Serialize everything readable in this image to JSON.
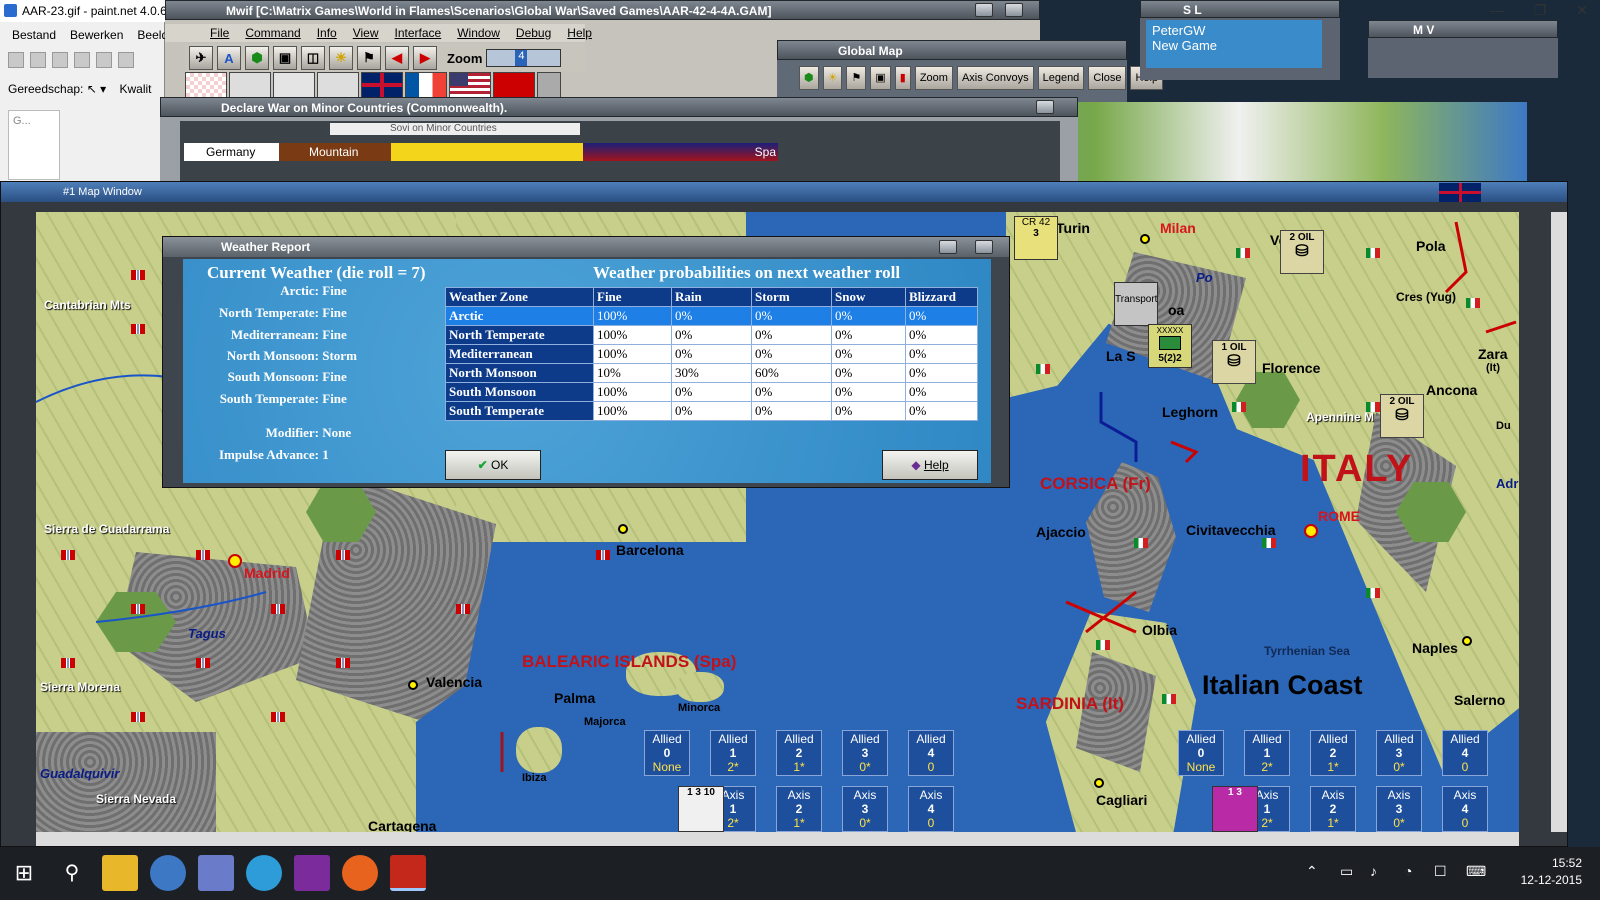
{
  "paint": {
    "title": "AAR-23.gif - paint.net 4.0.6",
    "menu": [
      "Bestand",
      "Bewerken",
      "Beeld"
    ],
    "tool_label": "Gereedschap:",
    "quality_label": "Kwalit",
    "panel_label": "G..."
  },
  "mwif": {
    "title": "Mwif [C:\\Matrix Games\\World in Flames\\Scenarios\\Global War\\Saved Games\\AAR-42-4-4A.GAM]",
    "menu": [
      "File",
      "Command",
      "Info",
      "View",
      "Interface",
      "Window",
      "Debug",
      "Help"
    ],
    "zoom_label": "Zoom",
    "zoom_value": "4"
  },
  "declare_war": {
    "title": "Declare War on Minor Countries (Commonwealth).",
    "header_hint": "Sovi on Minor Countries",
    "row": {
      "country": "Germany",
      "terrain": "Mountain",
      "tail": "Spa"
    }
  },
  "global_map": {
    "title": "Global Map",
    "buttons": [
      "Zoom",
      "Axis Convoys",
      "Legend",
      "Close",
      "Help"
    ]
  },
  "sl_window": {
    "title": "S L",
    "player": "PeterGW",
    "status": "New Game"
  },
  "mv_window": {
    "title": "M V"
  },
  "map_window": {
    "title": "#1 Map Window"
  },
  "weather": {
    "dialog_title": "Weather Report",
    "current_heading": "Current Weather (die roll = 7)",
    "prob_heading": "Weather probabilities on next weather roll",
    "current": [
      {
        "zone": "Arctic:",
        "value": "Fine"
      },
      {
        "zone": "North Temperate:",
        "value": "Fine"
      },
      {
        "zone": "Mediterranean:",
        "value": "Fine"
      },
      {
        "zone": "North Monsoon:",
        "value": "Storm"
      },
      {
        "zone": "South Monsoon:",
        "value": "Fine"
      },
      {
        "zone": "South Temperate:",
        "value": "Fine"
      }
    ],
    "modifier_label": "Modifier:",
    "modifier_value": "None",
    "impulse_label": "Impulse Advance:",
    "impulse_value": "1",
    "columns": [
      "Weather Zone",
      "Fine",
      "Rain",
      "Storm",
      "Snow",
      "Blizzard"
    ],
    "rows": [
      [
        "Arctic",
        "100%",
        "0%",
        "0%",
        "0%",
        "0%"
      ],
      [
        "North Temperate",
        "100%",
        "0%",
        "0%",
        "0%",
        "0%"
      ],
      [
        "Mediterranean",
        "100%",
        "0%",
        "0%",
        "0%",
        "0%"
      ],
      [
        "North Monsoon",
        "10%",
        "30%",
        "60%",
        "0%",
        "0%"
      ],
      [
        "South Monsoon",
        "100%",
        "0%",
        "0%",
        "0%",
        "0%"
      ],
      [
        "South Temperate",
        "100%",
        "0%",
        "0%",
        "0%",
        "0%"
      ]
    ],
    "selected_row": 0,
    "ok_label": "OK",
    "help_label": "Help"
  },
  "map": {
    "labels": {
      "cantabrian": "Cantabrian Mts",
      "guadarrama": "Sierra de Guadarrama",
      "madrid": "Madrid",
      "tagus": "Tagus",
      "sierra_morena": "Sierra Morena",
      "guadalquivir": "Guadalquivir",
      "sierra_nevada": "Sierra Nevada",
      "cartagena": "Cartagena",
      "valencia": "Valencia",
      "barcelona": "Barcelona",
      "balearic": "BALEARIC ISLANDS (Spa)",
      "palma": "Palma",
      "majorca": "Majorca",
      "minorca": "Minorca",
      "ibiza": "Ibiza",
      "milan": "Milan",
      "turin": "Turin",
      "po": "Po",
      "genoa": "oa",
      "la_spezia": "La S",
      "florence": "Florence",
      "leghorn": "Leghorn",
      "ancona": "Ancona",
      "apennine": "Apennine M",
      "pola": "Pola",
      "venice": "Ve",
      "cres": "Cres (Yug)",
      "zara": "Zara",
      "zara_it": "(It)",
      "du": "Du",
      "adr": "Adr",
      "italy": "ITALY",
      "rome": "ROME",
      "corsica": "CORSICA (Fr)",
      "ajaccio": "Ajaccio",
      "civitavecchia": "Civitavecchia",
      "olbia": "Olbia",
      "tyrrhenian": "Tyrrhenian Sea",
      "naples": "Naples",
      "salerno": "Salerno",
      "sardinia": "SARDINIA (It)",
      "italian_coast": "Italian Coast",
      "cagliari": "Cagliari"
    },
    "counters": {
      "oil1": "2 OIL",
      "oil2": "1 OIL",
      "oil3": "2 OIL",
      "corps": "CR 42",
      "corps_str": "3",
      "hq_label": "XXXXX",
      "hq_str": "5(2)2",
      "transport": "Transport"
    }
  },
  "tallies_left": [
    {
      "side": "Allied",
      "num": "0",
      "val": "None"
    },
    {
      "side": "Allied",
      "num": "1",
      "val": "2*"
    },
    {
      "side": "Allied",
      "num": "2",
      "val": "1*"
    },
    {
      "side": "Allied",
      "num": "3",
      "val": "0*"
    },
    {
      "side": "Allied",
      "num": "4",
      "val": "0"
    }
  ],
  "axis_left": [
    {
      "side": "Axis",
      "num": "1",
      "val": "2*"
    },
    {
      "side": "Axis",
      "num": "2",
      "val": "1*"
    },
    {
      "side": "Axis",
      "num": "3",
      "val": "0*"
    },
    {
      "side": "Axis",
      "num": "4",
      "val": "0"
    }
  ],
  "tallies_right": [
    {
      "side": "Allied",
      "num": "0",
      "val": "None"
    },
    {
      "side": "Allied",
      "num": "1",
      "val": "2*"
    },
    {
      "side": "Allied",
      "num": "2",
      "val": "1*"
    },
    {
      "side": "Allied",
      "num": "3",
      "val": "0*"
    },
    {
      "side": "Allied",
      "num": "4",
      "val": "0"
    }
  ],
  "axis_right": [
    {
      "side": "Axis",
      "num": "1",
      "val": "2*"
    },
    {
      "side": "Axis",
      "num": "2",
      "val": "1*"
    },
    {
      "side": "Axis",
      "num": "3",
      "val": "0*"
    },
    {
      "side": "Axis",
      "num": "4",
      "val": "0"
    }
  ],
  "taskbar": {
    "time": "15:52",
    "date": "12-12-2015"
  }
}
